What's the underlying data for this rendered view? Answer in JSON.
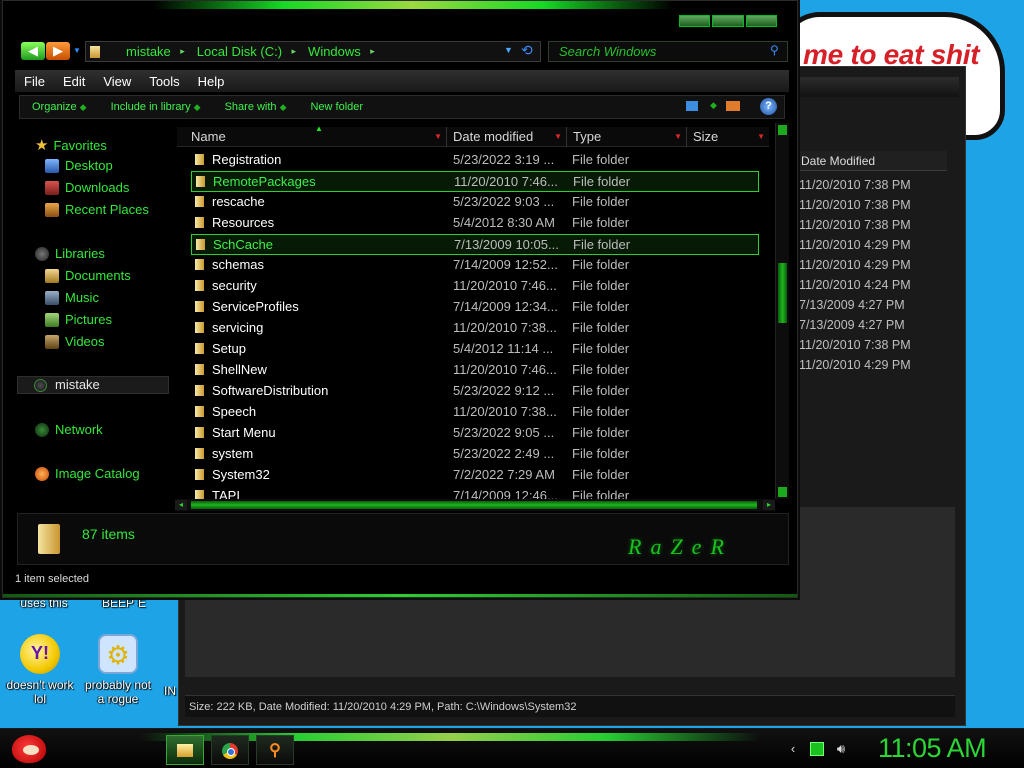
{
  "desktop": {
    "banner_text": "me to eat shit",
    "partial_labels": [
      "uses this",
      "BEEP",
      "E"
    ],
    "icons": [
      {
        "label_line1": "doesn't work",
        "label_line2": "lol",
        "icon": "yahoo-messenger-icon"
      },
      {
        "label_line1": "probably not",
        "label_line2": "a rogue",
        "icon": "gear-app-icon"
      }
    ],
    "partial_icon_label": "IN"
  },
  "background_window": {
    "column_header": "Date Modified",
    "dates": [
      "11/20/2010 7:38 PM",
      "11/20/2010 7:38 PM",
      "11/20/2010 7:38 PM",
      "11/20/2010 4:29 PM",
      "11/20/2010 4:29 PM",
      "11/20/2010 4:24 PM",
      "7/13/2009 4:27 PM",
      "7/13/2009 4:27 PM",
      "11/20/2010 7:38 PM",
      "11/20/2010 4:29 PM"
    ],
    "status_text": "Size: 222 KB, Date Modified: 11/20/2010 4:29 PM, Path: C:\\Windows\\System32"
  },
  "main_window": {
    "address": {
      "crumbs": [
        "mistake",
        "Local Disk (C:)",
        "Windows"
      ]
    },
    "search_placeholder": "Search Windows",
    "menu": [
      "File",
      "Edit",
      "View",
      "Tools",
      "Help"
    ],
    "commands": [
      "Organize",
      "Include in library",
      "Share with",
      "New folder"
    ],
    "nav": {
      "favorites": "Favorites",
      "desktop": "Desktop",
      "downloads": "Downloads",
      "recent_places": "Recent Places",
      "libraries": "Libraries",
      "documents": "Documents",
      "music": "Music",
      "pictures": "Pictures",
      "videos": "Videos",
      "user": "mistake",
      "network": "Network",
      "image_catalog": "Image Catalog"
    },
    "columns": {
      "name": "Name",
      "date": "Date modified",
      "type": "Type",
      "size": "Size"
    },
    "files": [
      {
        "name": "Registration",
        "date": "5/23/2022 3:19 ...",
        "type": "File folder",
        "selected": false
      },
      {
        "name": "RemotePackages",
        "date": "11/20/2010 7:46...",
        "type": "File folder",
        "selected": true
      },
      {
        "name": "rescache",
        "date": "5/23/2022 9:03 ...",
        "type": "File folder",
        "selected": false
      },
      {
        "name": "Resources",
        "date": "5/4/2012 8:30 AM",
        "type": "File folder",
        "selected": false
      },
      {
        "name": "SchCache",
        "date": "7/13/2009 10:05...",
        "type": "File folder",
        "selected": false,
        "hover": true
      },
      {
        "name": "schemas",
        "date": "7/14/2009 12:52...",
        "type": "File folder",
        "selected": false
      },
      {
        "name": "security",
        "date": "11/20/2010 7:46...",
        "type": "File folder",
        "selected": false
      },
      {
        "name": "ServiceProfiles",
        "date": "7/14/2009 12:34...",
        "type": "File folder",
        "selected": false
      },
      {
        "name": "servicing",
        "date": "11/20/2010 7:38...",
        "type": "File folder",
        "selected": false
      },
      {
        "name": "Setup",
        "date": "5/4/2012 11:14 ...",
        "type": "File folder",
        "selected": false
      },
      {
        "name": "ShellNew",
        "date": "11/20/2010 7:46...",
        "type": "File folder",
        "selected": false
      },
      {
        "name": "SoftwareDistribution",
        "date": "5/23/2022 9:12 ...",
        "type": "File folder",
        "selected": false
      },
      {
        "name": "Speech",
        "date": "11/20/2010 7:38...",
        "type": "File folder",
        "selected": false
      },
      {
        "name": "Start Menu",
        "date": "5/23/2022 9:05 ...",
        "type": "File folder",
        "selected": false
      },
      {
        "name": "system",
        "date": "5/23/2022 2:49 ...",
        "type": "File folder",
        "selected": false
      },
      {
        "name": "System32",
        "date": "7/2/2022 7:29 AM",
        "type": "File folder",
        "selected": false
      },
      {
        "name": "TAPI",
        "date": "7/14/2009 12:46...",
        "type": "File folder",
        "selected": false
      }
    ],
    "item_count": "87 items",
    "logo_text": "RaZeR",
    "status": "1 item selected"
  },
  "taskbar": {
    "clock": "11:05 AM"
  },
  "colors": {
    "accent_green": "#33e83a",
    "selection_border": "#2bd02f",
    "desktop_blue": "#1ea3e6"
  }
}
